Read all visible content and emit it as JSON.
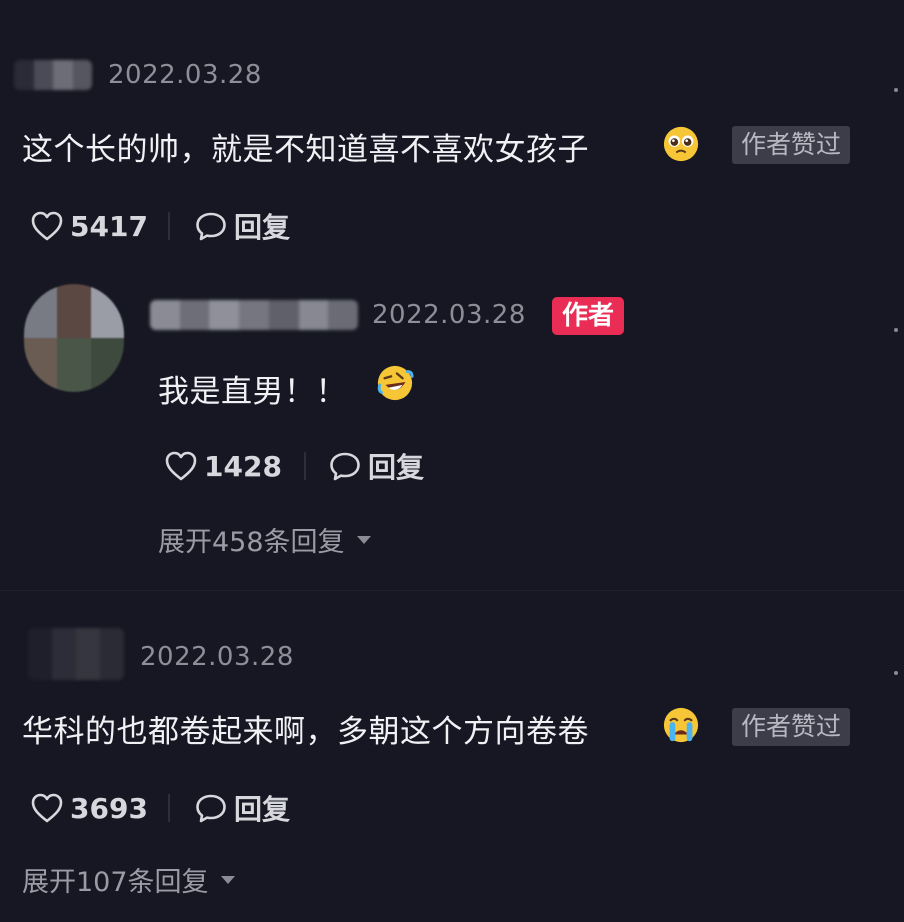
{
  "comments": [
    {
      "date": "2022.03.28",
      "text": "这个长的帅，就是不知道喜不喜欢女孩子",
      "emoji": "pleading-face-icon",
      "badge": "作者赞过",
      "likes": "5417",
      "reply_label": "回复"
    },
    {
      "date": "2022.03.28",
      "author_badge": "作者",
      "text": "我是直男！！",
      "emoji": "rolling-laughing-face-icon",
      "likes": "1428",
      "reply_label": "回复",
      "expand_label": "展开458条回复"
    },
    {
      "date": "2022.03.28",
      "text": "华科的也都卷起来啊，多朝这个方向卷卷",
      "emoji": "crying-face-icon",
      "badge": "作者赞过",
      "likes": "3693",
      "reply_label": "回复",
      "expand_label": "展开107条回复"
    }
  ],
  "colors": {
    "background": "#161722",
    "author_badge": "#ea2d54",
    "liked_badge_bg": "#3c3d49",
    "muted_text": "#8d8e97"
  }
}
